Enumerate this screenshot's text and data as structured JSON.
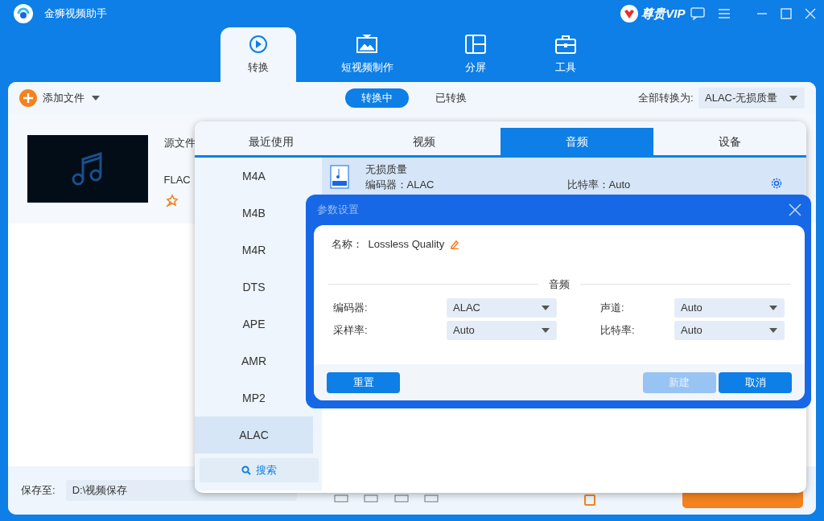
{
  "window": {
    "title": "金狮视频助手",
    "vip": "尊贵VIP"
  },
  "main_tabs": [
    {
      "label": "转换",
      "kind": "convert",
      "selected": true
    },
    {
      "label": "短视频制作",
      "kind": "video",
      "selected": false
    },
    {
      "label": "分屏",
      "kind": "split",
      "selected": false
    },
    {
      "label": "工具",
      "kind": "tools",
      "selected": false
    }
  ],
  "toolbar": {
    "add_files": "添加文件",
    "segments": [
      {
        "label": "转换中",
        "selected": true
      },
      {
        "label": "已转换",
        "selected": false
      }
    ],
    "convert_all_label": "全部转换为:",
    "convert_all_value": "ALAC-无损质量"
  },
  "file": {
    "source_label": "源文件",
    "format": "FLAC"
  },
  "format_panel": {
    "tabs": [
      {
        "label": "最近使用",
        "selected": false
      },
      {
        "label": "视频",
        "selected": false
      },
      {
        "label": "音频",
        "selected": true
      },
      {
        "label": "设备",
        "selected": false
      }
    ],
    "formats": [
      {
        "label": "M4A",
        "selected": false
      },
      {
        "label": "M4B",
        "selected": false
      },
      {
        "label": "M4R",
        "selected": false
      },
      {
        "label": "DTS",
        "selected": false
      },
      {
        "label": "APE",
        "selected": false
      },
      {
        "label": "AMR",
        "selected": false
      },
      {
        "label": "MP2",
        "selected": false
      },
      {
        "label": "ALAC",
        "selected": true
      }
    ],
    "search": "搜索",
    "presets": [
      {
        "name": "无损质量",
        "encoder": "编码器：ALAC",
        "bitrate": "比特率：Auto",
        "selected": true
      }
    ]
  },
  "dialog": {
    "title": "参数设置",
    "name_label": "名称：",
    "name_value": "Lossless Quality",
    "section": "音频",
    "fields": [
      {
        "label": "编码器:",
        "value": "ALAC"
      },
      {
        "label": "声道:",
        "value": "Auto"
      },
      {
        "label": "采样率:",
        "value": "Auto"
      },
      {
        "label": "比特率:",
        "value": "Auto"
      }
    ],
    "buttons": [
      {
        "label": "重置",
        "disabled": false
      },
      {
        "label": "新建",
        "disabled": true
      },
      {
        "label": "取消",
        "disabled": false
      }
    ]
  },
  "bottom": {
    "save_label": "保存至:",
    "save_path": "D:\\视频保存",
    "merge_checked": false
  }
}
